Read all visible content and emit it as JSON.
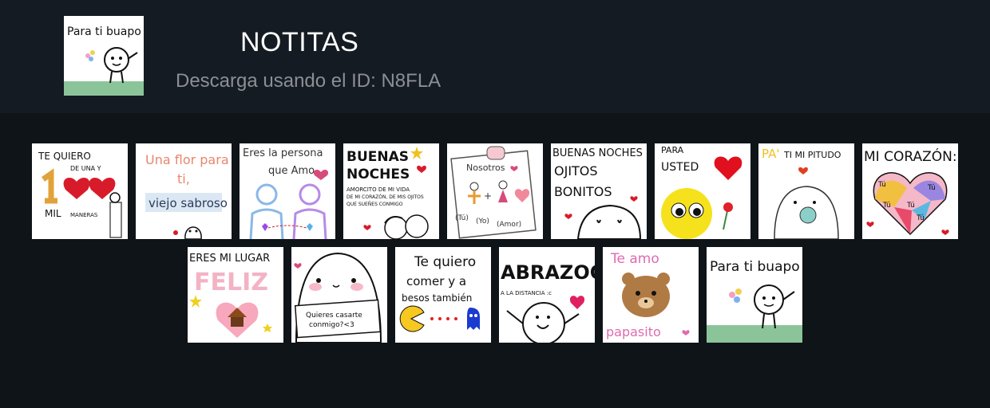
{
  "pack": {
    "title": "NOTITAS",
    "download_label": "Descarga usando el ID: N8FLA",
    "thumb_text": "Para ti buapo"
  },
  "stickers": [
    {
      "name": "te-quiero-100-mil",
      "lines": [
        "TE QUIERO",
        "DE UNA Y",
        "MIL",
        "MANERAS"
      ]
    },
    {
      "name": "una-flor-para-ti",
      "lines": [
        "Una flor para",
        "ti,",
        "viejo sabroso"
      ]
    },
    {
      "name": "eres-la-persona",
      "lines": [
        "Eres la persona",
        "que Amo"
      ]
    },
    {
      "name": "buenas-noches",
      "lines": [
        "BUENAS",
        "NOCHES",
        "AMORCITO DE MI VIDA",
        "DE MI CORAZÓN, DE MIS OJITOS",
        "QUE SUEÑES CONMIGO"
      ]
    },
    {
      "name": "nosotros",
      "lines": [
        "Nosotros",
        "(Tú)",
        "(Yo)",
        "(Amor)"
      ]
    },
    {
      "name": "buenas-noches-ojitos",
      "lines": [
        "BUENAS NOCHES",
        "OJITOS",
        "BONITOS"
      ]
    },
    {
      "name": "para-usted",
      "lines": [
        "PARA",
        "USTED"
      ]
    },
    {
      "name": "pa-ti-mi-pitudo",
      "lines": [
        "PA'",
        "TI MI PITUDO"
      ]
    },
    {
      "name": "mi-corazon",
      "lines": [
        "MI CORAZÓN:",
        "Tú",
        "Tú",
        "Tú",
        "Tú",
        "Tú"
      ]
    },
    {
      "name": "eres-mi-lugar-feliz",
      "lines": [
        "ERES MI LUGAR",
        "FELIZ"
      ]
    },
    {
      "name": "quieres-casarte",
      "lines": [
        "Quieres casarte",
        "conmigo?<3"
      ]
    },
    {
      "name": "te-quiero-comer",
      "lines": [
        "Te quiero",
        "comer y a",
        "besos también"
      ]
    },
    {
      "name": "abrazoo",
      "lines": [
        "ABRAZOO",
        "A LA DISTANCIA :c"
      ]
    },
    {
      "name": "te-amo-papasito",
      "lines": [
        "Te amo",
        "papasito"
      ]
    },
    {
      "name": "para-ti-buapo",
      "lines": [
        "Para ti buapo"
      ]
    }
  ],
  "colors": {
    "background": "#0f1419",
    "header": "#141b23",
    "title": "#ffffff",
    "subtitle": "#8c8f94",
    "heart_red": "#d81b2a"
  }
}
